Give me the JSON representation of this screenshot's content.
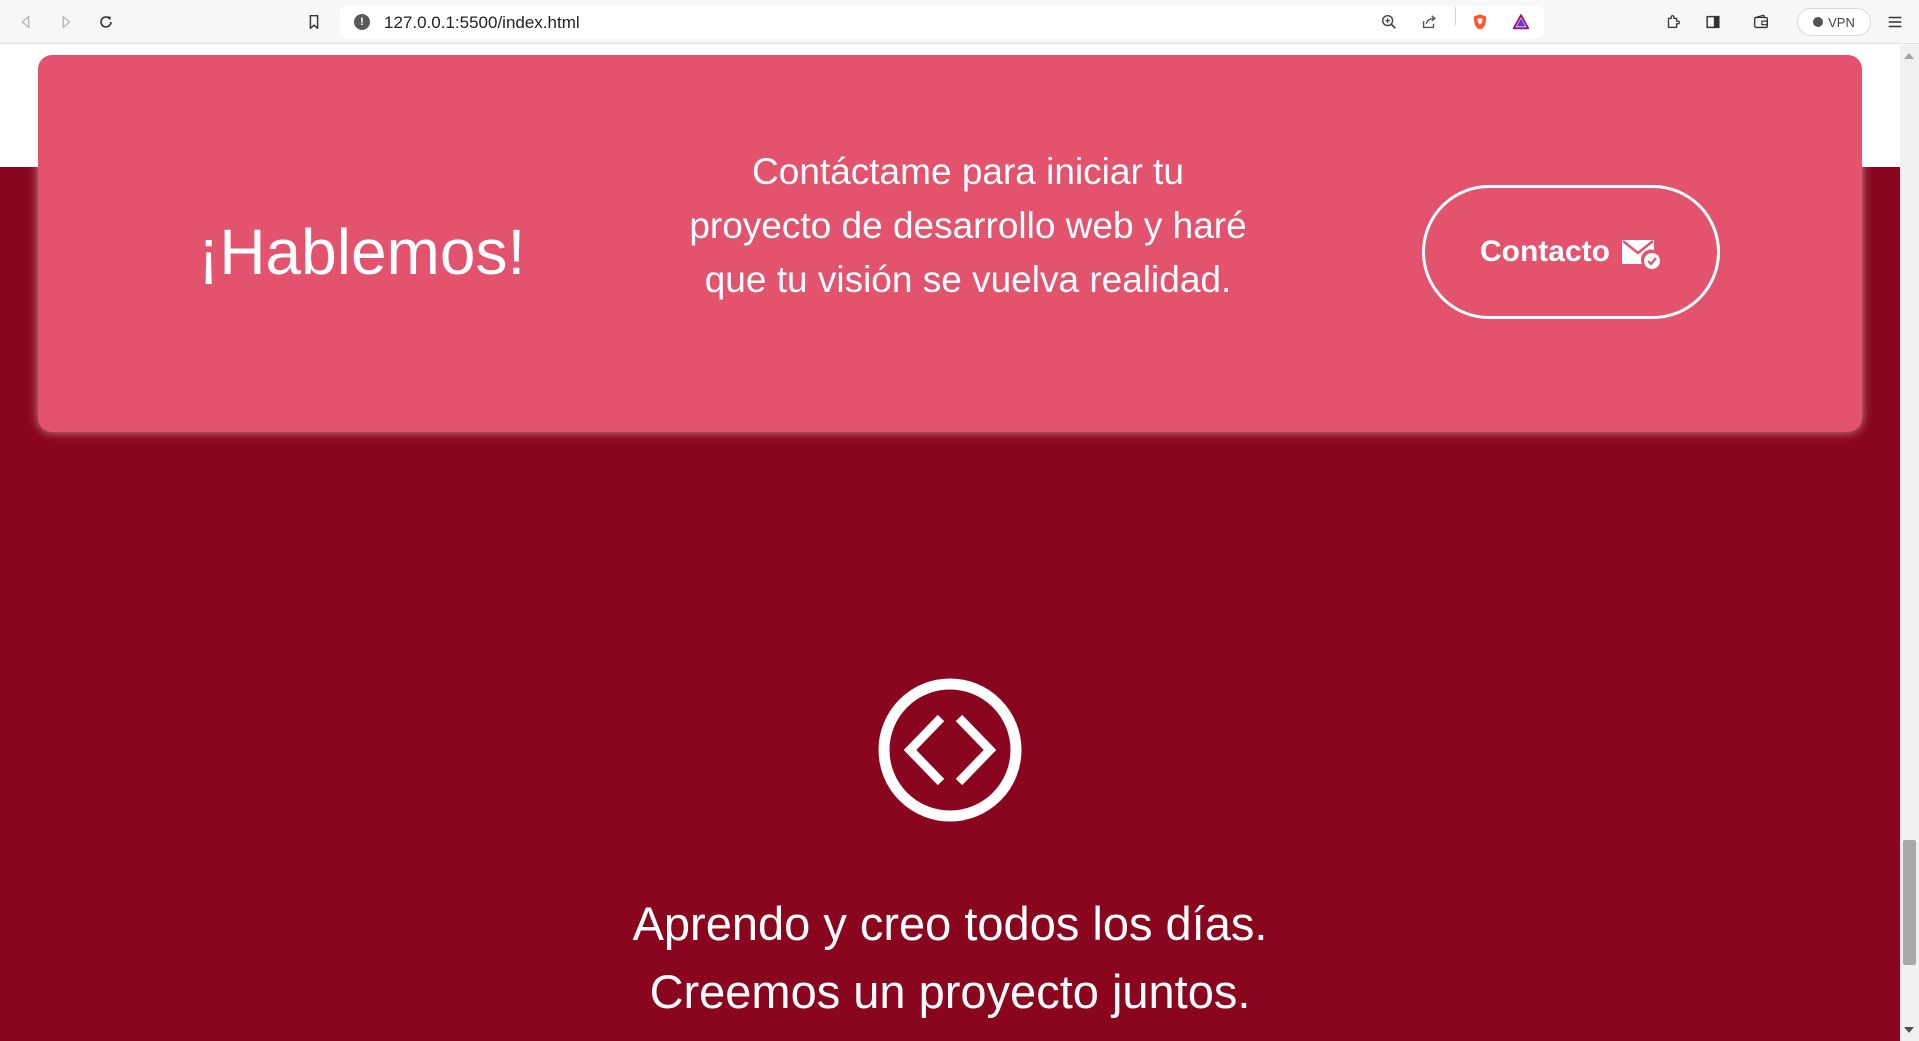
{
  "browser": {
    "url": "127.0.0.1:5500/index.html",
    "info_icon_glyph": "!",
    "vpn_label": "VPN",
    "icons": [
      "back-icon",
      "forward-icon",
      "reload-icon",
      "bookmark-icon",
      "info-icon",
      "zoom-icon",
      "share-icon",
      "brave-shields-icon",
      "brave-rewards-icon",
      "extensions-icon",
      "sidebar-icon",
      "wallet-icon",
      "menu-icon"
    ]
  },
  "cta": {
    "title": "¡Hablemos!",
    "text": "Contáctame para iniciar tu proyecto de desarrollo web y haré que tu visión se vuelva realidad.",
    "button_label": "Contacto",
    "button_icon": "mail-check-icon"
  },
  "section": {
    "icon": "code-icon",
    "tagline_line1": "Aprendo y creo todos los días.",
    "tagline_line2": "Creemos un proyecto juntos."
  },
  "colors": {
    "card": "#e4536d",
    "section": "#8a061e",
    "text": "#ffffff",
    "brave_orange": "#fb542b"
  }
}
